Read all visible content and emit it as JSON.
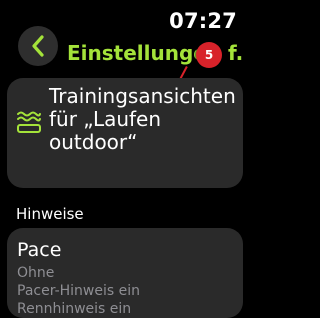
{
  "status_bar": {
    "time": "07:27"
  },
  "nav": {
    "title": "Einstellungen f...",
    "back_icon": "chevron-left-icon",
    "notification_count": "5",
    "accent_color": "#a4e33a"
  },
  "workout_card": {
    "icon": "workout-views-icon",
    "icon_color": "#a4e33a",
    "text": "Trainingsansich­ten für „Laufen outdoor“"
  },
  "section": {
    "header": "Hinweise"
  },
  "pace_card": {
    "title": "Pace",
    "lines": [
      "Ohne",
      "Pacer-Hinweis ein",
      "Rennhinweis ein"
    ]
  }
}
